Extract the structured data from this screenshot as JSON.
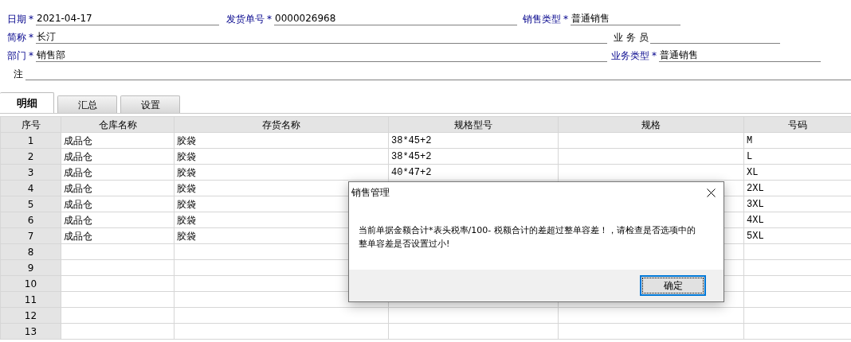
{
  "form_rows": [
    {
      "fields": [
        {
          "label": "日期",
          "required": true,
          "mark": "*",
          "value": "2021-04-17"
        },
        {
          "label": "发货单号",
          "required": true,
          "mark": "*",
          "value": "0000026968"
        },
        {
          "label": "销售类型",
          "required": true,
          "mark": "*",
          "value": "普通销售"
        }
      ]
    },
    {
      "fields": [
        {
          "label": "简称",
          "required": true,
          "mark": "*",
          "value": "长汀"
        },
        {
          "label": "业 务 员",
          "required": false
        }
      ]
    },
    {
      "fields": [
        {
          "label": "部门",
          "required": true,
          "mark": "*",
          "value": "销售部"
        },
        {
          "label": "业务类型",
          "required": true,
          "mark": "*",
          "value": "普通销售"
        }
      ]
    },
    {
      "fields": [
        {
          "label": "注",
          "required": false
        }
      ]
    }
  ],
  "tabs": [
    {
      "label": "明细",
      "selected": true
    },
    {
      "label": "汇总",
      "selected": false
    },
    {
      "label": "设置",
      "selected": false
    }
  ],
  "table": {
    "columns": [
      "序号",
      "仓库名称",
      "存货名称",
      "规格型号",
      "规格",
      "号码"
    ],
    "rows": [
      {
        "index": "1",
        "warehouse": "成品仓",
        "item": "胶袋",
        "model": "38*45+2",
        "code": "M"
      },
      {
        "index": "2",
        "warehouse": "成品仓",
        "item": "胶袋",
        "model": "38*45+2",
        "code": "L"
      },
      {
        "index": "3",
        "warehouse": "成品仓",
        "item": "胶袋",
        "model": "40*47+2",
        "code": "XL"
      },
      {
        "index": "4",
        "warehouse": "成品仓",
        "item": "胶袋",
        "code": "2XL"
      },
      {
        "index": "5",
        "warehouse": "成品仓",
        "item": "胶袋",
        "code": "3XL"
      },
      {
        "index": "6",
        "warehouse": "成品仓",
        "item": "胶袋",
        "code": "4XL"
      },
      {
        "index": "7",
        "warehouse": "成品仓",
        "item": "胶袋",
        "code": "5XL"
      },
      {
        "index": "8"
      },
      {
        "index": "9"
      },
      {
        "index": "10"
      },
      {
        "index": "11"
      },
      {
        "index": "12"
      },
      {
        "index": "13"
      }
    ]
  },
  "dialog": {
    "title": "销售管理",
    "message_lines": [
      "当前单据金额合计*表头税率/100- 税额合计的差超过整单容差！，请检查是否选项中的",
      "整单容差是否设置过小!"
    ],
    "button": "确定"
  }
}
